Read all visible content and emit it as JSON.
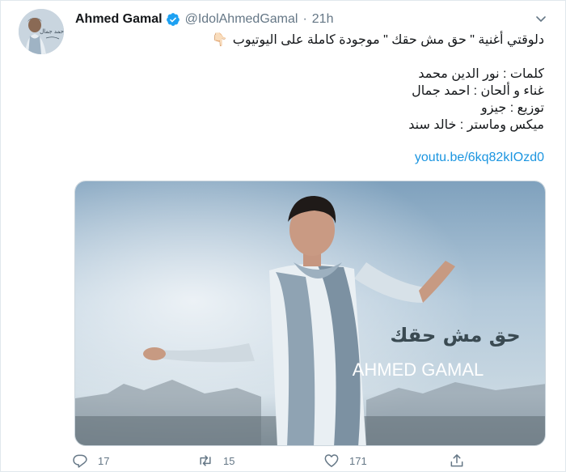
{
  "author": {
    "display_name": "Ahmed Gamal",
    "handle": "@IdolAhmedGamal",
    "separator": "·",
    "time": "21h",
    "verified": true,
    "avatar_caption": "أحمد جمال"
  },
  "tweet": {
    "line1": "دلوقتي أغنية \" حق مش حقك \" موجودة كاملة على اليوتيوب",
    "line1_emoji": "👇🏻",
    "credits": [
      "كلمات : نور الدين محمد",
      "غناء و ألحان : احمد جمال",
      "توزيع : جيزو",
      "ميكس وماستر : خالد سند"
    ],
    "link": "youtu.be/6kq82kIOzd0"
  },
  "media": {
    "song_title": "حق مش حقك",
    "artist": "AHMED GAMAL"
  },
  "actions": {
    "reply_count": "17",
    "retweet_count": "15",
    "like_count": "171"
  },
  "colors": {
    "link": "#1b95e0",
    "verified": "#1da1f2",
    "muted": "#657786",
    "text": "#14171a"
  },
  "icons": {
    "verified": "verified-badge-icon",
    "menu": "chevron-down-icon",
    "reply": "reply-icon",
    "retweet": "retweet-icon",
    "like": "heart-icon",
    "share": "share-icon"
  }
}
